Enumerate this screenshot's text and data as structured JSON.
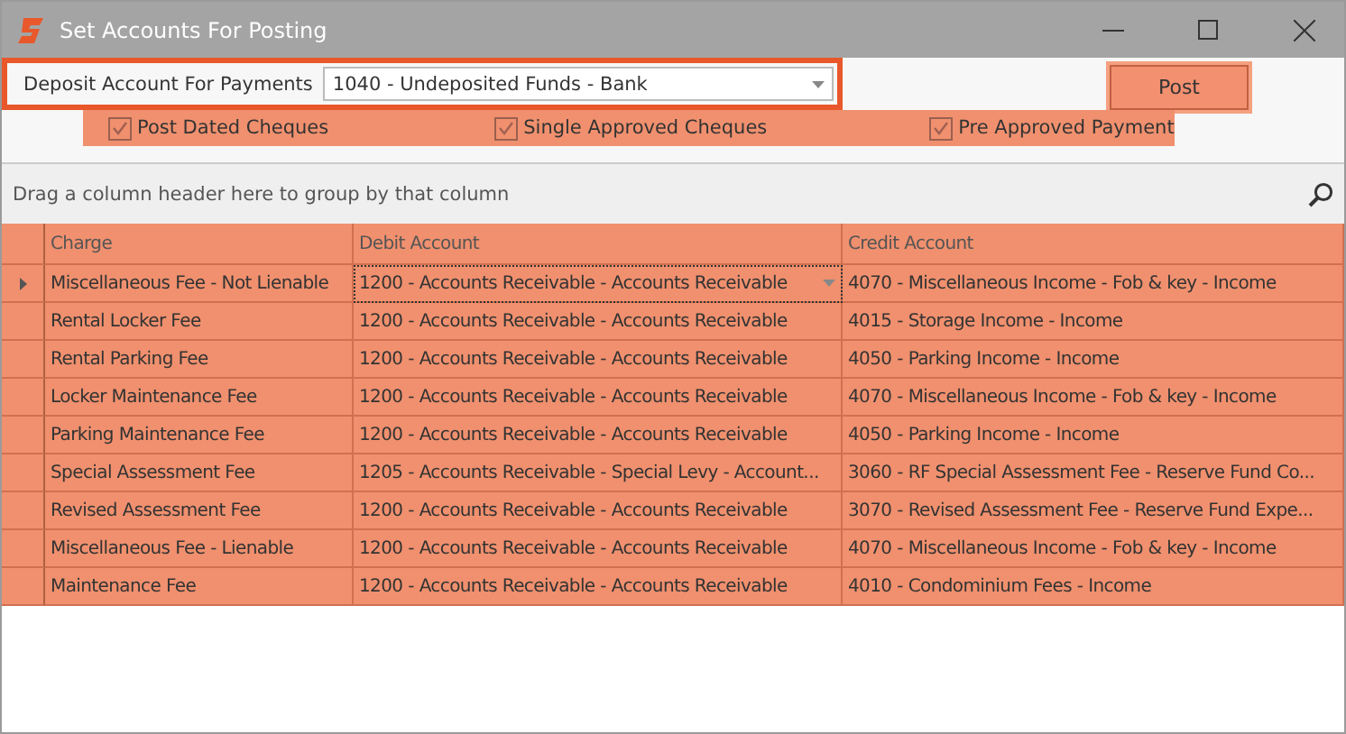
{
  "window": {
    "title": "Set Accounts For Posting"
  },
  "deposit": {
    "label": "Deposit Account For Payments",
    "value": "1040 - Undeposited Funds - Bank"
  },
  "post_button": "Post",
  "options": [
    {
      "label": "Post Dated Cheques",
      "checked": true
    },
    {
      "label": "Single Approved Cheques",
      "checked": true
    },
    {
      "label": "Pre Approved Payment",
      "checked": true
    }
  ],
  "group_panel": {
    "hint": "Drag a column header here to group by that column"
  },
  "table": {
    "columns": [
      "Charge",
      "Debit Account",
      "Credit Account"
    ],
    "rows": [
      {
        "selected": true,
        "cells": [
          "Miscellaneous Fee - Not Lienable",
          "1200 - Accounts Receivable - Accounts Receivable",
          "4070 - Miscellaneous Income - Fob & key - Income"
        ]
      },
      {
        "selected": false,
        "cells": [
          "Rental Locker Fee",
          "1200 - Accounts Receivable - Accounts Receivable",
          "4015 - Storage Income  - Income"
        ]
      },
      {
        "selected": false,
        "cells": [
          "Rental Parking Fee",
          "1200 - Accounts Receivable - Accounts Receivable",
          "4050 - Parking Income - Income"
        ]
      },
      {
        "selected": false,
        "cells": [
          "Locker Maintenance Fee",
          "1200 - Accounts Receivable - Accounts Receivable",
          "4070 - Miscellaneous Income - Fob & key - Income"
        ]
      },
      {
        "selected": false,
        "cells": [
          "Parking Maintenance Fee",
          "1200 - Accounts Receivable - Accounts Receivable",
          "4050 - Parking Income - Income"
        ]
      },
      {
        "selected": false,
        "cells": [
          "Special Assessment Fee",
          "1205 - Accounts Receivable - Special Levy - Account...",
          "3060 - RF Special Assessment Fee - Reserve Fund Co..."
        ]
      },
      {
        "selected": false,
        "cells": [
          "Revised Assessment Fee",
          "1200 - Accounts Receivable - Accounts Receivable",
          "3070 - Revised Assessment Fee - Reserve Fund Expe..."
        ]
      },
      {
        "selected": false,
        "cells": [
          "Miscellaneous Fee - Lienable",
          "1200 - Accounts Receivable - Accounts Receivable",
          "4070 - Miscellaneous Income - Fob & key - Income"
        ]
      },
      {
        "selected": false,
        "cells": [
          "Maintenance Fee",
          "1200 - Accounts Receivable - Accounts Receivable",
          "4010 - Condominium Fees - Income"
        ]
      }
    ]
  }
}
